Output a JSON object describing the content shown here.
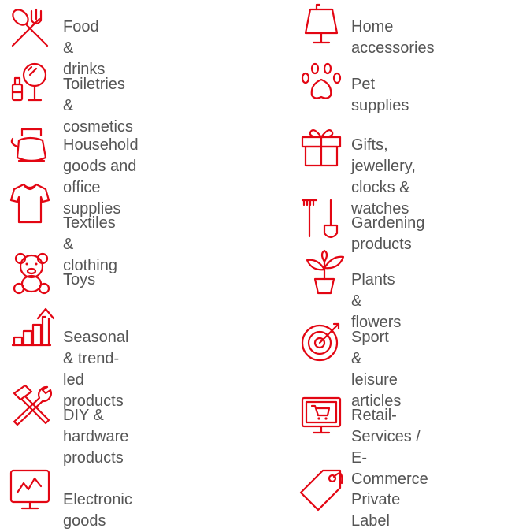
{
  "accent_color": "#e30613",
  "text_color": "#555555",
  "categories_left": [
    {
      "label": "Food & drinks",
      "icon": "fork-spoon-icon"
    },
    {
      "label": "Toiletries & cosmetics",
      "icon": "cosmetics-mirror-icon"
    },
    {
      "label": "Household goods and\noffice supplies",
      "icon": "kettle-icon"
    },
    {
      "label": "Textiles & clothing",
      "icon": "tshirt-icon"
    },
    {
      "label": "Toys",
      "icon": "teddy-bear-icon"
    },
    {
      "label": "Seasonal & trend-led\nproducts",
      "icon": "trend-chart-icon"
    },
    {
      "label": "DIY & hardware\nproducts",
      "icon": "hammer-wrench-icon"
    },
    {
      "label": "Electronic goods",
      "icon": "monitor-graph-icon"
    }
  ],
  "categories_right": [
    {
      "label": "Home accessories",
      "icon": "lamp-icon"
    },
    {
      "label": "Pet supplies",
      "icon": "paw-print-icon"
    },
    {
      "label": "Gifts, jewellery,\nclocks & watches",
      "icon": "gift-box-icon"
    },
    {
      "label": "Gardening products",
      "icon": "rake-shovel-icon"
    },
    {
      "label": "Plants & flowers",
      "icon": "potted-plant-icon"
    },
    {
      "label": "Sport & leisure\narticles",
      "icon": "target-dart-icon"
    },
    {
      "label": "Retail-Services /\nE-Commerce",
      "icon": "monitor-cart-icon"
    },
    {
      "label": "Private Label",
      "icon": "price-tag-icon"
    }
  ]
}
